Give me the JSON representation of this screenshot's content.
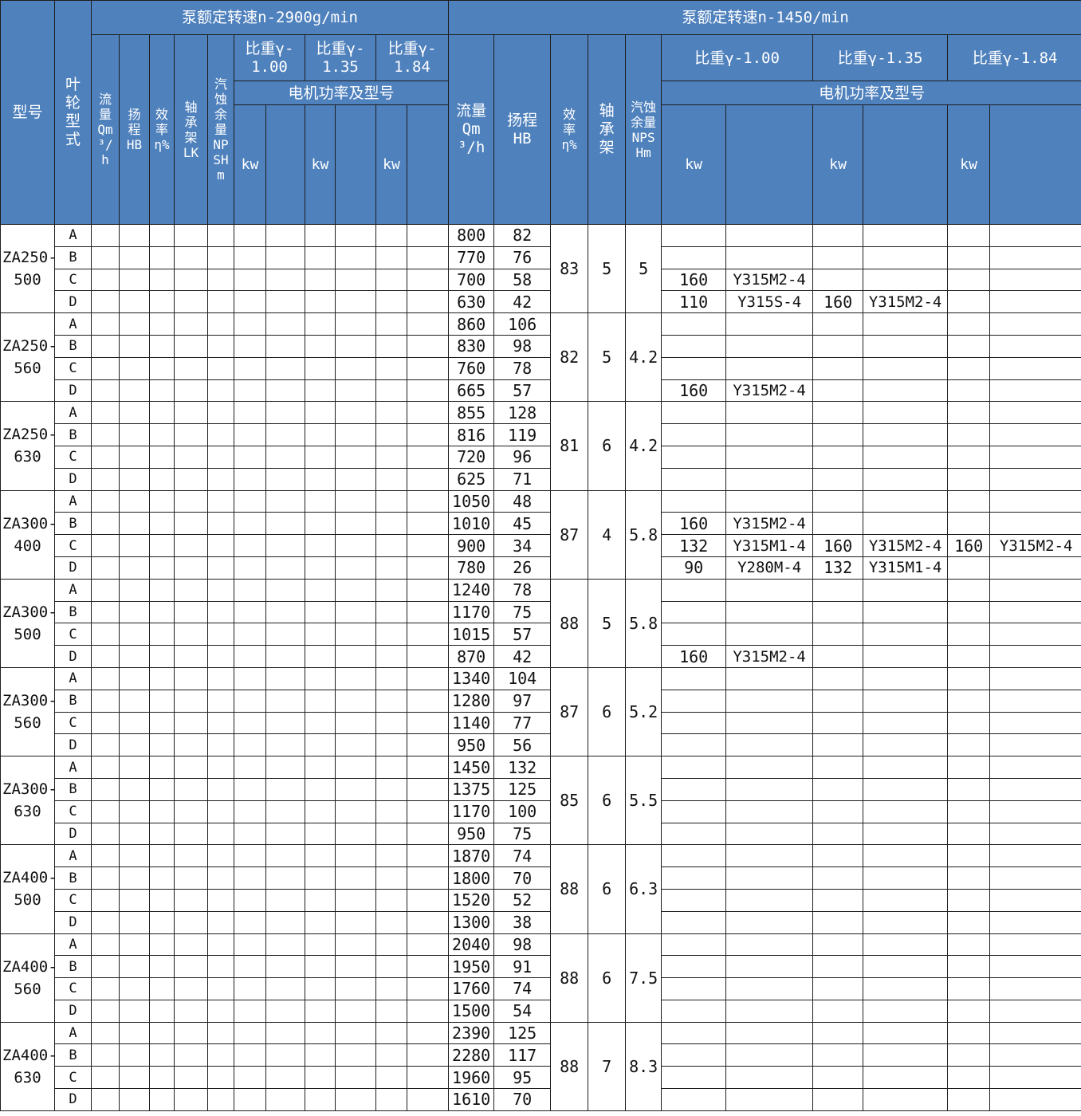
{
  "header": {
    "model": "型号",
    "impeller": "叶轮型式",
    "speed_2900": "泵额定转速n-2900g/min",
    "speed_1450": "泵额定转速n-1450/min",
    "flow_2900": "流量Qm³/h",
    "head_2900": "扬程HB",
    "eff_2900": "效率η%",
    "bearing_2900": "轴承架LK",
    "npsh_2900": "汽蚀余量NPSHm",
    "sg100_2900": "比重γ-1.00",
    "sg135_2900": "比重γ-1.35",
    "sg184_2900": "比重γ-1.84",
    "motor_2900": "电机功率及型号",
    "kw": "kw",
    "flow_1450": "流量Qm³/h",
    "head_1450": "扬程HB",
    "eff_1450": "效率η%",
    "bearing_1450": "轴承架",
    "npsh_1450": "汽蚀余量NPSHm",
    "sg100_1450": "比重γ-1.00",
    "sg135_1450": "比重γ-1.35",
    "sg184_1450": "比重γ-1.84",
    "motor_1450": "电机功率及型号"
  },
  "models": [
    {
      "name": "ZA250-500",
      "eff": "83",
      "bearing": "5",
      "npsh": "5",
      "rows": [
        {
          "impeller": "A",
          "flow": "800",
          "head": "82",
          "kw1": "",
          "m1": "",
          "kw2": "",
          "m2": "",
          "kw3": "",
          "m3": ""
        },
        {
          "impeller": "B",
          "flow": "770",
          "head": "76",
          "kw1": "",
          "m1": "",
          "kw2": "",
          "m2": "",
          "kw3": "",
          "m3": ""
        },
        {
          "impeller": "C",
          "flow": "700",
          "head": "58",
          "kw1": "160",
          "m1": "Y315M2-4",
          "kw2": "",
          "m2": "",
          "kw3": "",
          "m3": ""
        },
        {
          "impeller": "D",
          "flow": "630",
          "head": "42",
          "kw1": "110",
          "m1": "Y315S-4",
          "kw2": "160",
          "m2": "Y315M2-4",
          "kw3": "",
          "m3": ""
        }
      ]
    },
    {
      "name": "ZA250-560",
      "eff": "82",
      "bearing": "5",
      "npsh": "4.2",
      "rows": [
        {
          "impeller": "A",
          "flow": "860",
          "head": "106",
          "kw1": "",
          "m1": "",
          "kw2": "",
          "m2": "",
          "kw3": "",
          "m3": ""
        },
        {
          "impeller": "B",
          "flow": "830",
          "head": "98",
          "kw1": "",
          "m1": "",
          "kw2": "",
          "m2": "",
          "kw3": "",
          "m3": ""
        },
        {
          "impeller": "C",
          "flow": "760",
          "head": "78",
          "kw1": "",
          "m1": "",
          "kw2": "",
          "m2": "",
          "kw3": "",
          "m3": ""
        },
        {
          "impeller": "D",
          "flow": "665",
          "head": "57",
          "kw1": "160",
          "m1": "Y315M2-4",
          "kw2": "",
          "m2": "",
          "kw3": "",
          "m3": ""
        }
      ]
    },
    {
      "name": "ZA250-630",
      "eff": "81",
      "bearing": "6",
      "npsh": "4.2",
      "rows": [
        {
          "impeller": "A",
          "flow": "855",
          "head": "128",
          "kw1": "",
          "m1": "",
          "kw2": "",
          "m2": "",
          "kw3": "",
          "m3": ""
        },
        {
          "impeller": "B",
          "flow": "816",
          "head": "119",
          "kw1": "",
          "m1": "",
          "kw2": "",
          "m2": "",
          "kw3": "",
          "m3": ""
        },
        {
          "impeller": "C",
          "flow": "720",
          "head": "96",
          "kw1": "",
          "m1": "",
          "kw2": "",
          "m2": "",
          "kw3": "",
          "m3": ""
        },
        {
          "impeller": "D",
          "flow": "625",
          "head": "71",
          "kw1": "",
          "m1": "",
          "kw2": "",
          "m2": "",
          "kw3": "",
          "m3": ""
        }
      ]
    },
    {
      "name": "ZA300-400",
      "eff": "87",
      "bearing": "4",
      "npsh": "5.8",
      "rows": [
        {
          "impeller": "A",
          "flow": "1050",
          "head": "48",
          "kw1": "",
          "m1": "",
          "kw2": "",
          "m2": "",
          "kw3": "",
          "m3": ""
        },
        {
          "impeller": "B",
          "flow": "1010",
          "head": "45",
          "kw1": "160",
          "m1": "Y315M2-4",
          "kw2": "",
          "m2": "",
          "kw3": "",
          "m3": ""
        },
        {
          "impeller": "C",
          "flow": "900",
          "head": "34",
          "kw1": "132",
          "m1": "Y315M1-4",
          "kw2": "160",
          "m2": "Y315M2-4",
          "kw3": "160",
          "m3": "Y315M2-4"
        },
        {
          "impeller": "D",
          "flow": "780",
          "head": "26",
          "kw1": "90",
          "m1": "Y280M-4",
          "kw2": "132",
          "m2": "Y315M1-4",
          "kw3": "",
          "m3": ""
        }
      ]
    },
    {
      "name": "ZA300-500",
      "eff": "88",
      "bearing": "5",
      "npsh": "5.8",
      "rows": [
        {
          "impeller": "A",
          "flow": "1240",
          "head": "78",
          "kw1": "",
          "m1": "",
          "kw2": "",
          "m2": "",
          "kw3": "",
          "m3": ""
        },
        {
          "impeller": "B",
          "flow": "1170",
          "head": "75",
          "kw1": "",
          "m1": "",
          "kw2": "",
          "m2": "",
          "kw3": "",
          "m3": ""
        },
        {
          "impeller": "C",
          "flow": "1015",
          "head": "57",
          "kw1": "",
          "m1": "",
          "kw2": "",
          "m2": "",
          "kw3": "",
          "m3": ""
        },
        {
          "impeller": "D",
          "flow": "870",
          "head": "42",
          "kw1": "160",
          "m1": "Y315M2-4",
          "kw2": "",
          "m2": "",
          "kw3": "",
          "m3": ""
        }
      ]
    },
    {
      "name": "ZA300-560",
      "eff": "87",
      "bearing": "6",
      "npsh": "5.2",
      "rows": [
        {
          "impeller": "A",
          "flow": "1340",
          "head": "104",
          "kw1": "",
          "m1": "",
          "kw2": "",
          "m2": "",
          "kw3": "",
          "m3": ""
        },
        {
          "impeller": "B",
          "flow": "1280",
          "head": "97",
          "kw1": "",
          "m1": "",
          "kw2": "",
          "m2": "",
          "kw3": "",
          "m3": ""
        },
        {
          "impeller": "C",
          "flow": "1140",
          "head": "77",
          "kw1": "",
          "m1": "",
          "kw2": "",
          "m2": "",
          "kw3": "",
          "m3": ""
        },
        {
          "impeller": "D",
          "flow": "950",
          "head": "56",
          "kw1": "",
          "m1": "",
          "kw2": "",
          "m2": "",
          "kw3": "",
          "m3": ""
        }
      ]
    },
    {
      "name": "ZA300-630",
      "eff": "85",
      "bearing": "6",
      "npsh": "5.5",
      "rows": [
        {
          "impeller": "A",
          "flow": "1450",
          "head": "132",
          "kw1": "",
          "m1": "",
          "kw2": "",
          "m2": "",
          "kw3": "",
          "m3": ""
        },
        {
          "impeller": "B",
          "flow": "1375",
          "head": "125",
          "kw1": "",
          "m1": "",
          "kw2": "",
          "m2": "",
          "kw3": "",
          "m3": ""
        },
        {
          "impeller": "C",
          "flow": "1170",
          "head": "100",
          "kw1": "",
          "m1": "",
          "kw2": "",
          "m2": "",
          "kw3": "",
          "m3": ""
        },
        {
          "impeller": "D",
          "flow": "950",
          "head": "75",
          "kw1": "",
          "m1": "",
          "kw2": "",
          "m2": "",
          "kw3": "",
          "m3": ""
        }
      ]
    },
    {
      "name": "ZA400-500",
      "eff": "88",
      "bearing": "6",
      "npsh": "6.3",
      "rows": [
        {
          "impeller": "A",
          "flow": "1870",
          "head": "74",
          "kw1": "",
          "m1": "",
          "kw2": "",
          "m2": "",
          "kw3": "",
          "m3": ""
        },
        {
          "impeller": "B",
          "flow": "1800",
          "head": "70",
          "kw1": "",
          "m1": "",
          "kw2": "",
          "m2": "",
          "kw3": "",
          "m3": ""
        },
        {
          "impeller": "C",
          "flow": "1520",
          "head": "52",
          "kw1": "",
          "m1": "",
          "kw2": "",
          "m2": "",
          "kw3": "",
          "m3": ""
        },
        {
          "impeller": "D",
          "flow": "1300",
          "head": "38",
          "kw1": "",
          "m1": "",
          "kw2": "",
          "m2": "",
          "kw3": "",
          "m3": ""
        }
      ]
    },
    {
      "name": "ZA400-560",
      "eff": "88",
      "bearing": "6",
      "npsh": "7.5",
      "rows": [
        {
          "impeller": "A",
          "flow": "2040",
          "head": "98",
          "kw1": "",
          "m1": "",
          "kw2": "",
          "m2": "",
          "kw3": "",
          "m3": ""
        },
        {
          "impeller": "B",
          "flow": "1950",
          "head": "91",
          "kw1": "",
          "m1": "",
          "kw2": "",
          "m2": "",
          "kw3": "",
          "m3": ""
        },
        {
          "impeller": "C",
          "flow": "1760",
          "head": "74",
          "kw1": "",
          "m1": "",
          "kw2": "",
          "m2": "",
          "kw3": "",
          "m3": ""
        },
        {
          "impeller": "D",
          "flow": "1500",
          "head": "54",
          "kw1": "",
          "m1": "",
          "kw2": "",
          "m2": "",
          "kw3": "",
          "m3": ""
        }
      ]
    },
    {
      "name": "ZA400-630",
      "eff": "88",
      "bearing": "7",
      "npsh": "8.3",
      "rows": [
        {
          "impeller": "A",
          "flow": "2390",
          "head": "125",
          "kw1": "",
          "m1": "",
          "kw2": "",
          "m2": "",
          "kw3": "",
          "m3": ""
        },
        {
          "impeller": "B",
          "flow": "2280",
          "head": "117",
          "kw1": "",
          "m1": "",
          "kw2": "",
          "m2": "",
          "kw3": "",
          "m3": ""
        },
        {
          "impeller": "C",
          "flow": "1960",
          "head": "95",
          "kw1": "",
          "m1": "",
          "kw2": "",
          "m2": "",
          "kw3": "",
          "m3": ""
        },
        {
          "impeller": "D",
          "flow": "1610",
          "head": "70",
          "kw1": "",
          "m1": "",
          "kw2": "",
          "m2": "",
          "kw3": "",
          "m3": ""
        }
      ]
    }
  ],
  "colors": {
    "header_bg": "#4f81bd",
    "header_text": "#ffffff",
    "grid": "#1e1e1e"
  }
}
